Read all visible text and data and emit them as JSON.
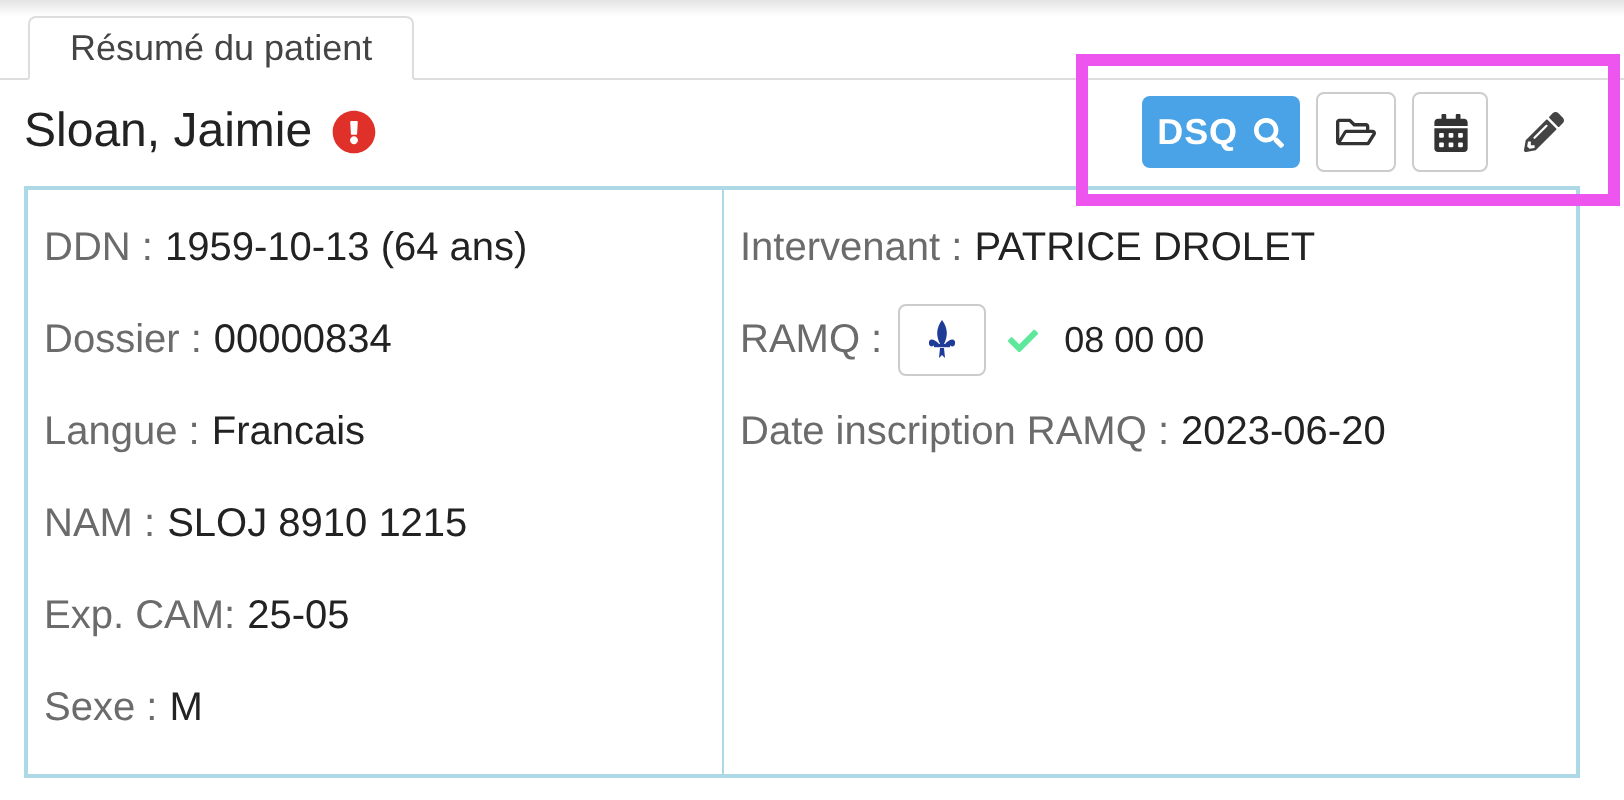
{
  "tabs": [
    {
      "label": "Résumé du patient",
      "selected": true
    }
  ],
  "patient": {
    "name": "Sloan, Jaimie",
    "alert": true
  },
  "toolbar": [
    {
      "kind": "dsq",
      "label": "DSQ"
    },
    {
      "kind": "folder"
    },
    {
      "kind": "calendar"
    },
    {
      "kind": "edit"
    }
  ],
  "left_fields": [
    {
      "label": "DDN :",
      "value": "1959-10-13 (64 ans)"
    },
    {
      "label": "Dossier :",
      "value": "00000834"
    },
    {
      "label": "Langue :",
      "value": "Francais"
    },
    {
      "label": "NAM :",
      "value": "SLOJ 8910 1215"
    },
    {
      "label": "Exp. CAM:",
      "value": "25-05"
    },
    {
      "label": "Sexe :",
      "value": "M"
    }
  ],
  "right_fields": [
    {
      "kind": "text",
      "label": "Intervenant :",
      "value": "PATRICE DROLET"
    },
    {
      "kind": "ramq",
      "label": "RAMQ :",
      "verified": true,
      "value": "08 00 00"
    },
    {
      "kind": "text",
      "label": "Date inscription RAMQ :",
      "value": "2023-06-20"
    }
  ]
}
